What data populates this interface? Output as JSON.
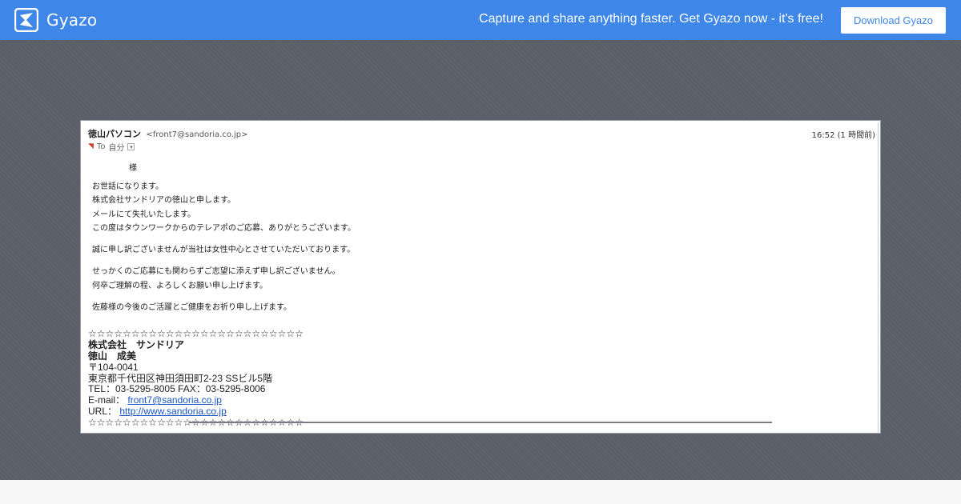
{
  "header": {
    "brand": "Gyazo",
    "promo": "Capture and share anything faster. Get Gyazo now - it's free!",
    "download_label": "Download Gyazo",
    "logo_icon": "gyazo-logo-icon",
    "accent": "#3e87e8"
  },
  "email": {
    "sender_name": "徳山パソコン",
    "sender_addr": "<front7@sandoria.co.jp>",
    "time": "16:52 (1 時間前)",
    "to_label": "To",
    "to_value": "自分",
    "salutation": "様",
    "paragraphs": [
      [
        "お世話になります。",
        "株式会社サンドリアの徳山と申します。",
        "メールにて失礼いたします。",
        "この度はタウンワークからのテレアポのご応募、ありがとうございます。"
      ],
      [
        "誠に申し訳ございませんが当社は女性中心とさせていただいております。"
      ],
      [
        "せっかくのご応募にも関わらずご志望に添えず申し訳ございません。",
        "何卒ご理解の程、よろしくお願い申し上げます。"
      ],
      [
        "佐藤様の今後のご活躍とご健康をお祈り申し上げます。"
      ]
    ],
    "signature": {
      "stars": "☆☆☆☆☆☆☆☆☆☆☆☆☆☆☆☆☆☆☆☆☆☆☆☆☆",
      "company": "株式会社　サンドリア",
      "person": "徳山　成美",
      "postal": "〒104-0041",
      "address": "東京都千代田区神田須田町2-23 SSビル5階",
      "phone": "TEL：03-5295-8005 FAX：03-5295-8006",
      "email_label": "E-mail：",
      "email": "front7@sandoria.co.jp",
      "url_label": "URL：",
      "url": "http://www.sandoria.co.jp"
    }
  }
}
